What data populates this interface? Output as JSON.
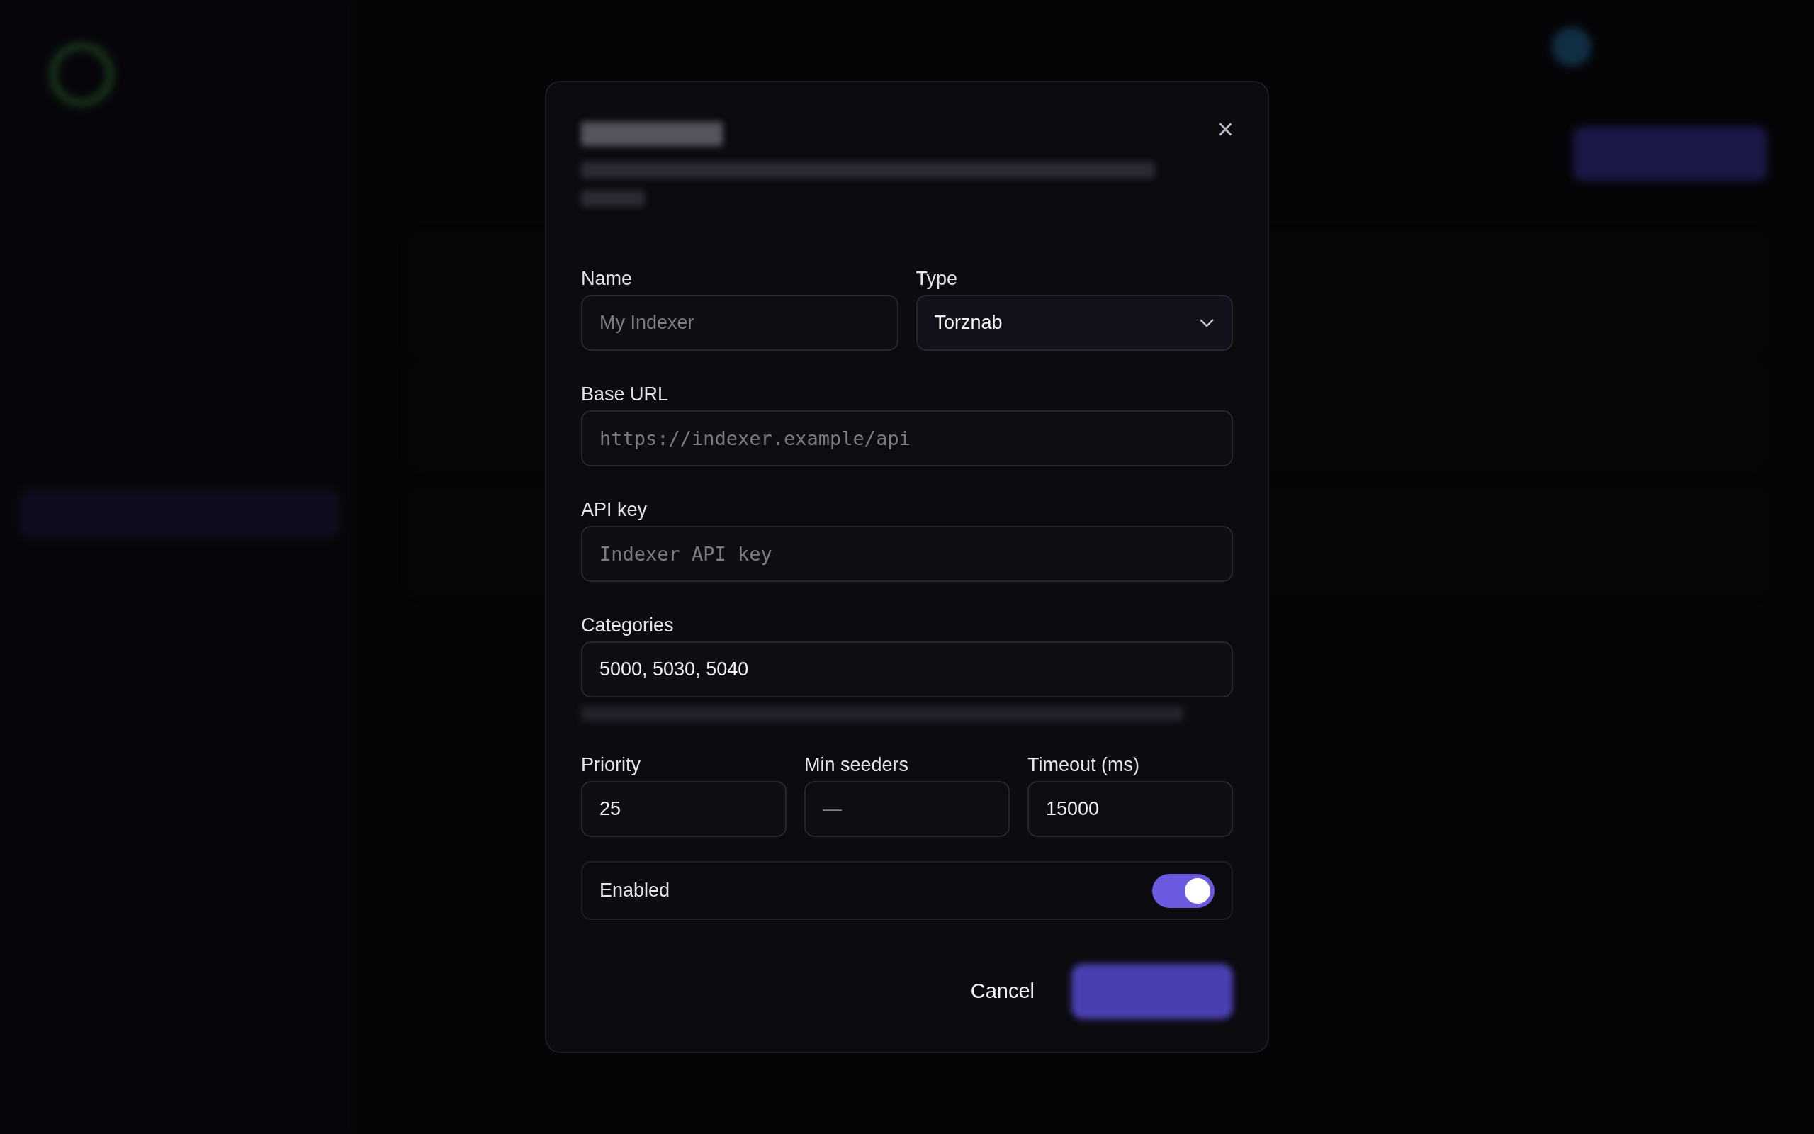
{
  "dialog": {
    "close_icon": "×",
    "rows": [
      {
        "fields": [
          {
            "kind": "text",
            "label": "Name",
            "placeholder": "My Indexer"
          },
          {
            "kind": "select",
            "label": "Type",
            "value": "Torznab"
          }
        ]
      },
      {
        "fields": [
          {
            "kind": "mono",
            "label": "Base URL",
            "placeholder": "https://indexer.example/api"
          }
        ]
      },
      {
        "fields": [
          {
            "kind": "mono",
            "label": "API key",
            "placeholder": "Indexer API key"
          }
        ]
      },
      {
        "fields": [
          {
            "kind": "text",
            "label": "Categories",
            "value": "5000, 5030, 5040"
          }
        ],
        "blurred_hint": true
      },
      {
        "fields": [
          {
            "kind": "text",
            "label": "Priority",
            "value": "25"
          },
          {
            "kind": "text",
            "label": "Min seeders",
            "placeholder": "—"
          },
          {
            "kind": "text",
            "label": "Timeout (ms)",
            "value": "15000"
          }
        ]
      }
    ],
    "toggle": {
      "label": "Enabled",
      "on": true
    },
    "cancel": "Cancel"
  }
}
